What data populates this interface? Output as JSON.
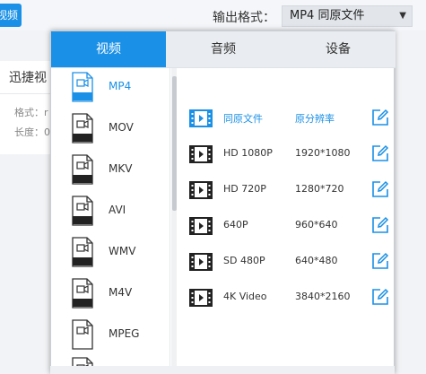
{
  "background": {
    "top_button_label": "视频",
    "output_format_label": "输出格式：",
    "output_format_value": "MP4  同原文件",
    "card_title": "迅捷视",
    "card_format_line": "格式：r",
    "card_length_line": "长度：0"
  },
  "tabs": [
    {
      "label": "视频"
    },
    {
      "label": "音频"
    },
    {
      "label": "设备"
    }
  ],
  "formats": [
    {
      "label": "MP4",
      "icon_tag": "MP4"
    },
    {
      "label": "MOV",
      "icon_tag": "MOV"
    },
    {
      "label": "MKV",
      "icon_tag": "MKV"
    },
    {
      "label": "AVI",
      "icon_tag": "AVI"
    },
    {
      "label": "WMV",
      "icon_tag": "WMV"
    },
    {
      "label": "M4V",
      "icon_tag": "M4V"
    },
    {
      "label": "MPEG",
      "icon_tag": ""
    }
  ],
  "presets": [
    {
      "name": "同原文件",
      "resolution": "原分辨率"
    },
    {
      "name": "HD 1080P",
      "resolution": "1920*1080"
    },
    {
      "name": "HD 720P",
      "resolution": "1280*720"
    },
    {
      "name": "640P",
      "resolution": "960*640"
    },
    {
      "name": "SD 480P",
      "resolution": "640*480"
    },
    {
      "name": "4K Video",
      "resolution": "3840*2160"
    }
  ],
  "colors": {
    "accent": "#1a90e6",
    "text": "#333333",
    "tab_inactive_bg": "#e9ecf0"
  },
  "icons": {
    "format_item": "video-file-icon",
    "preset_item": "film-icon",
    "preset_action": "edit-icon",
    "dropdown": "chevron-down-icon"
  }
}
